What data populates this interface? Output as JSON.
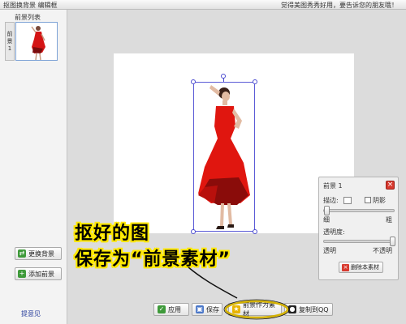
{
  "window": {
    "title": "抠图换背景 编辑框",
    "tip": "觉得美图秀秀好用，要告诉您的朋友哦！"
  },
  "left_panel": {
    "list_title": "前景列表",
    "list_side": [
      "前",
      "景",
      "1"
    ],
    "buttons": [
      {
        "label": "更换背景",
        "icon": "swap-icon"
      },
      {
        "label": "添加前景",
        "icon": "add-icon"
      }
    ],
    "feedback_link": "提意见"
  },
  "fg_panel": {
    "title": "前景 1",
    "stroke_label": "描边:",
    "shadow_label": "阴影",
    "thickness_min": "细",
    "thickness_max": "粗",
    "opacity_label": "透明度:",
    "opacity_min": "透明",
    "opacity_max": "不透明",
    "delete_label": "删除本素材",
    "thickness_level": 0.0,
    "opacity_level": 1.0
  },
  "toolbar": {
    "apply": "应用",
    "save": "保存",
    "save_as_material": "前景作为素材",
    "copy_to_qq": "复制到QQ"
  },
  "annotation": {
    "line1": "抠好的图",
    "line2": "保存为“前景素材”"
  },
  "colors": {
    "annotation_fill": "#ffe800",
    "ellipse": "#d4b200",
    "selection": "#5b5bd6",
    "apply_icon": "#3e9a3a",
    "delete_icon": "#d83a2f"
  }
}
